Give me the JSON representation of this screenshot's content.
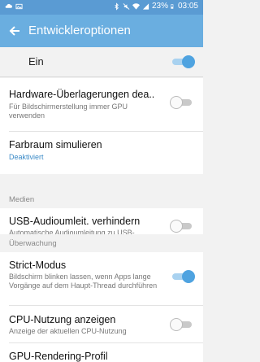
{
  "statusbar": {
    "battery": "23%",
    "time": "03:05"
  },
  "appbar": {
    "title": "Entwickleroptionen"
  },
  "master": {
    "label": "Ein",
    "enabled": true
  },
  "rows": [
    {
      "title": "Hardware-Überlagerungen dea..",
      "sub": "Für Bildschirmerstellung immer GPU verwenden",
      "toggle": false
    },
    {
      "title": "Farbraum simulieren",
      "sub": "Deaktiviert"
    },
    {
      "title": "USB-Audioumleit. verhindern",
      "sub": "Automatische Audioumleitung zu USB-Peripheriegeräten verhindern.",
      "toggle": false
    },
    {
      "title": "Strict-Modus",
      "sub": "Bildschirm blinken lassen, wenn Apps lange Vorgänge auf dem Haupt-Thread durchführen",
      "toggle": true
    },
    {
      "title": "CPU-Nutzung anzeigen",
      "sub": "Anzeige der aktuellen CPU-Nutzung",
      "toggle": false
    },
    {
      "title": "GPU-Rendering-Profil"
    }
  ],
  "sections": {
    "medien": "Medien",
    "ueberwachung": "Überwachung"
  },
  "colors": {
    "statusbar": "#5a9bd3",
    "appbar": "#6aaee0",
    "accent": "#4fa3e0"
  }
}
